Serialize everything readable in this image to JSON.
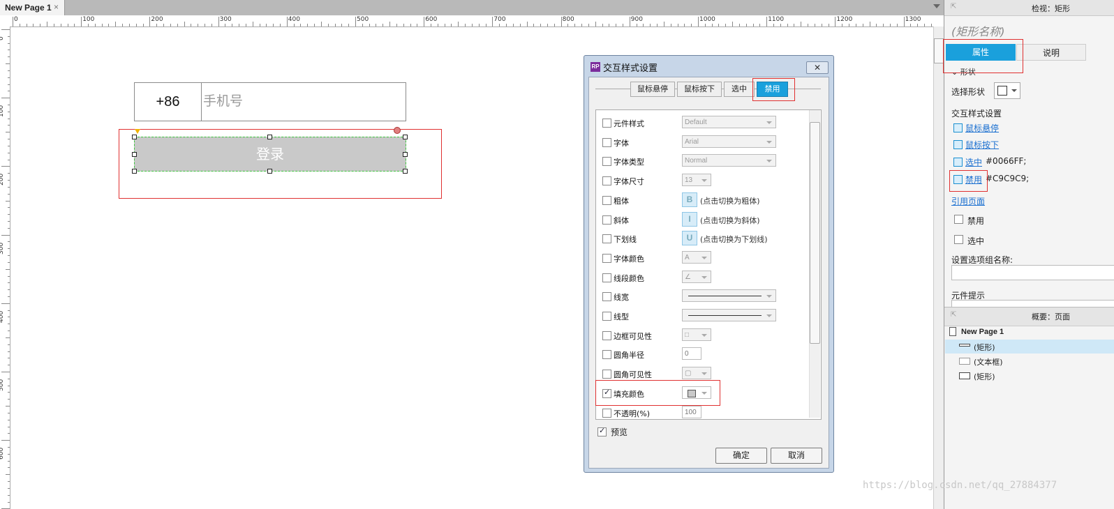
{
  "page_tab": {
    "label": "New Page 1",
    "close": "×"
  },
  "ruler": {
    "h_labels": [
      "0",
      "100",
      "200",
      "300",
      "400",
      "500",
      "600",
      "700",
      "800",
      "900",
      "1000",
      "1100",
      "1200",
      "1300"
    ],
    "v_labels": [
      "0",
      "100",
      "200",
      "300",
      "400",
      "500",
      "600"
    ]
  },
  "canvas": {
    "country_code": "+86",
    "phone_placeholder": "手机号",
    "login_label": "登录"
  },
  "dialog": {
    "title": "交互样式设置",
    "logo": "RP",
    "close": "✕",
    "tabs": [
      "鼠标悬停",
      "鼠标按下",
      "选中",
      "禁用"
    ],
    "active_tab": "禁用",
    "rows": [
      {
        "label": "元件样式",
        "control": "select",
        "value": "Default",
        "checked": false
      },
      {
        "label": "字体",
        "control": "select",
        "value": "Arial",
        "checked": false
      },
      {
        "label": "字体类型",
        "control": "select",
        "value": "Normal",
        "checked": false
      },
      {
        "label": "字体尺寸",
        "control": "small",
        "value": "13",
        "checked": false
      },
      {
        "label": "粗体",
        "control": "toggle",
        "value": "B",
        "note": "(点击切换为粗体)",
        "checked": false
      },
      {
        "label": "斜体",
        "control": "toggle",
        "value": "I",
        "note": "(点击切换为斜体)",
        "checked": false
      },
      {
        "label": "下划线",
        "control": "toggle",
        "value": "U",
        "note": "(点击切换为下划线)",
        "checked": false
      },
      {
        "label": "字体颜色",
        "control": "small",
        "value": "A",
        "checked": false
      },
      {
        "label": "线段颜色",
        "control": "small",
        "value": "∠",
        "checked": false
      },
      {
        "label": "线宽",
        "control": "line",
        "value": "",
        "checked": false
      },
      {
        "label": "线型",
        "control": "line",
        "value": "",
        "checked": false
      },
      {
        "label": "边框可见性",
        "control": "small",
        "value": "□",
        "checked": false
      },
      {
        "label": "圆角半径",
        "control": "input",
        "value": "0",
        "checked": false
      },
      {
        "label": "圆角可见性",
        "control": "small",
        "value": "▢",
        "checked": false
      },
      {
        "label": "填充颜色",
        "control": "swatch",
        "value": "",
        "checked": true
      },
      {
        "label": "不透明(%)",
        "control": "input",
        "value": "100",
        "checked": false
      }
    ],
    "preview_label": "预览",
    "ok_label": "确定",
    "cancel_label": "取消"
  },
  "inspector": {
    "header_title": "检视：矩形",
    "shape_name": "(矩形名称)",
    "tab_props": "属性",
    "tab_notes": "说明",
    "section_shape": "形状",
    "select_shape_label": "选择形状",
    "interaction_title": "交互样式设置",
    "hover_link": "鼠标悬停",
    "mousedown_link": "鼠标按下",
    "selected_link": "选中",
    "selected_value": "#0066FF;",
    "disabled_link": "禁用",
    "disabled_value": "#C9C9C9;",
    "ref_page_link": "引用页面",
    "chk_disabled": "禁用",
    "chk_selected": "选中",
    "group_name_label": "设置选项组名称:",
    "tooltip_label": "元件提示"
  },
  "outline": {
    "header_title": "概要：页面",
    "page": "New Page 1",
    "items": [
      "(矩形)",
      "(文本框)",
      "(矩形)"
    ]
  },
  "watermark": "https://blog.csdn.net/qq_27884377",
  "colors": {
    "accent": "#1aa0dc",
    "disabled_fill": "#C9C9C9",
    "highlight": "#e03030"
  }
}
